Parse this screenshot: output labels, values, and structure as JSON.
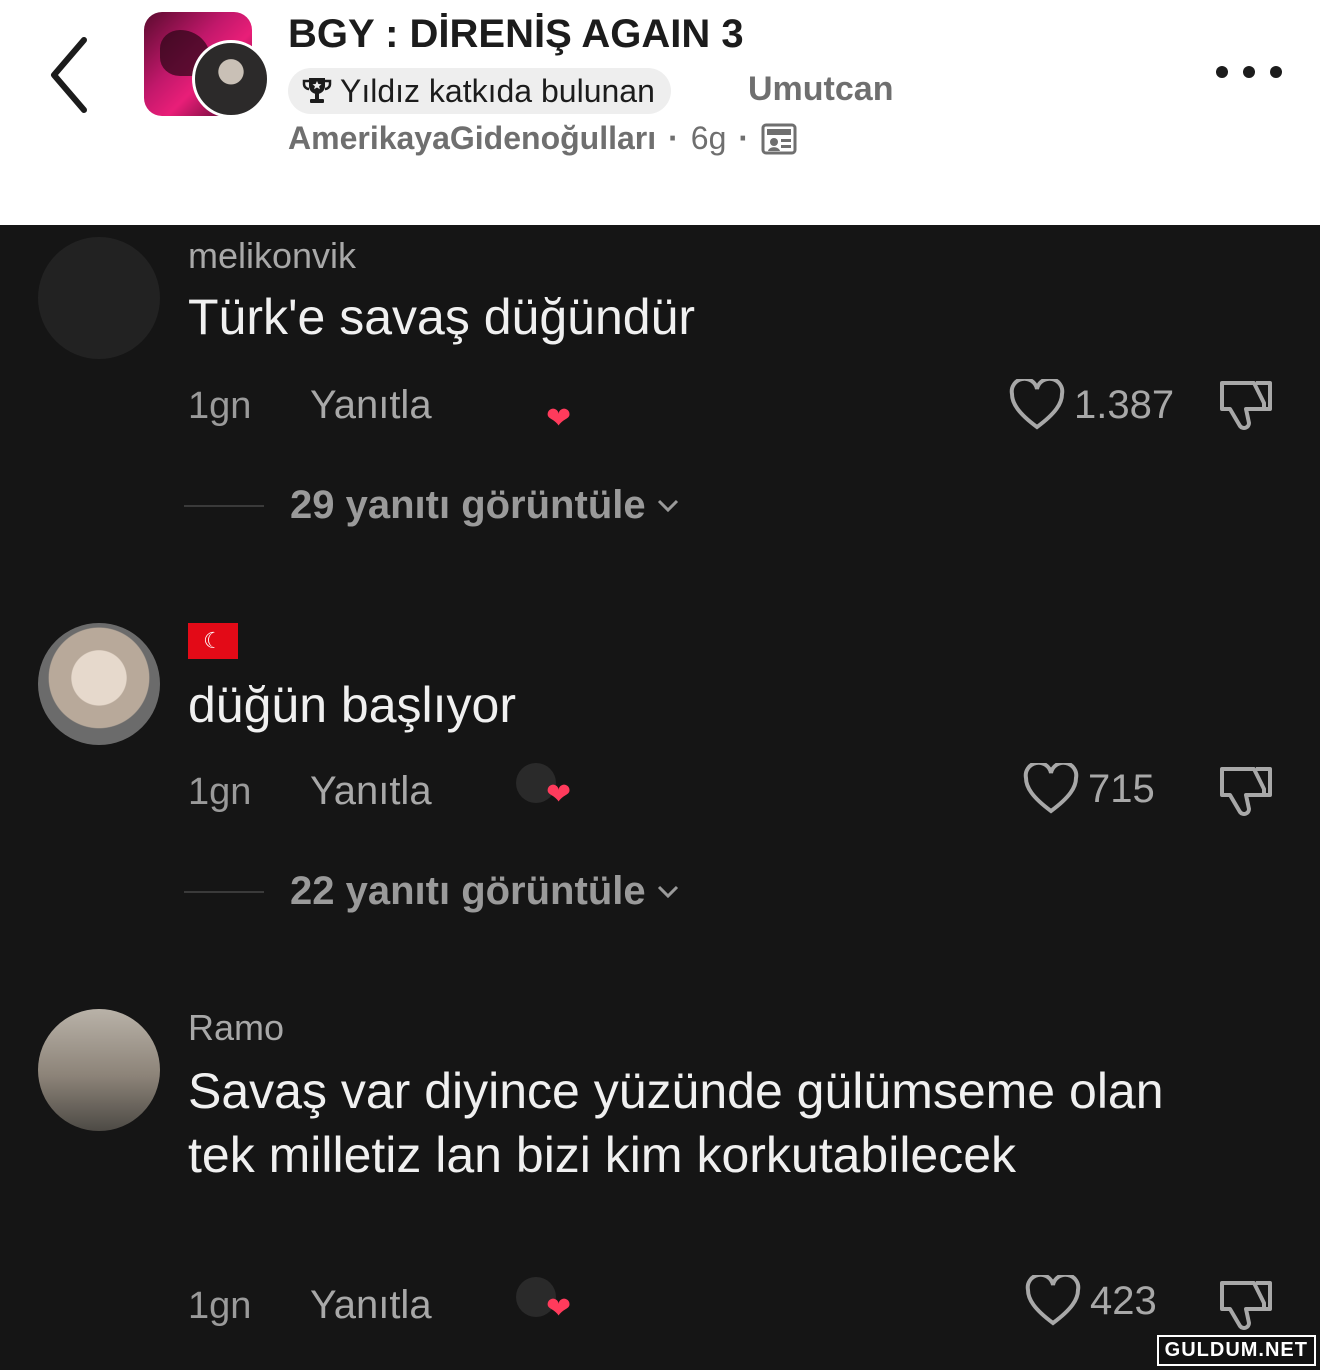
{
  "header": {
    "community_title": "BGY : DİRENİŞ AGAIN 3",
    "badge_label": "Yıldız katkıda bulunan",
    "username_part1": "Umutcan",
    "username_part2": "AmerikayaGidenoğulları",
    "separator": "·",
    "post_age": "6g"
  },
  "comments": [
    {
      "username": "melikonvik",
      "text": "Türk'e savaş düğündür",
      "age": "1gn",
      "reply_label": "Yanıtla",
      "likes": "1.387",
      "view_replies": "29 yanıtı görüntüle"
    },
    {
      "username": "",
      "flag": "☾",
      "text": "düğün başlıyor",
      "age": "1gn",
      "reply_label": "Yanıtla",
      "likes": "715",
      "view_replies": "22 yanıtı görüntüle"
    },
    {
      "username": "Ramo",
      "text": "Savaş var diyince yüzünde gülümseme olan tek milletiz lan bizi kim korkutabilecek",
      "age": "1gn",
      "reply_label": "Yanıtla",
      "likes": "423"
    }
  ],
  "watermark": "GULDUM.NET",
  "colors": {
    "heart": "#ff3b5c",
    "dark_bg": "#151515",
    "header_text": "#1c1c1c"
  }
}
